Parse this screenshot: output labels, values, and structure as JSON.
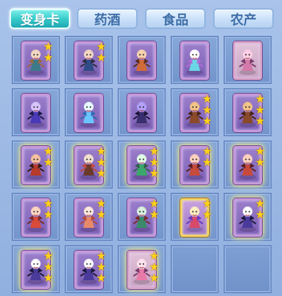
{
  "tabs": [
    {
      "label": "变身卡",
      "active": true
    },
    {
      "label": "药酒",
      "active": false
    },
    {
      "label": "食品",
      "active": false
    },
    {
      "label": "农产",
      "active": false
    }
  ],
  "icons": {
    "star": "★"
  },
  "items": [
    {
      "name": "transform-card-archer-girl",
      "stars": 2,
      "frame": "purple",
      "figure": "archer"
    },
    {
      "name": "transform-card-blade-girl",
      "stars": 2,
      "frame": "purple",
      "figure": "blade"
    },
    {
      "name": "transform-card-fox-warrior",
      "stars": 0,
      "frame": "purple",
      "figure": "fox"
    },
    {
      "name": "transform-card-unicorn",
      "stars": 0,
      "frame": "purple",
      "figure": "unicorn"
    },
    {
      "name": "transform-card-pink-beast",
      "stars": 0,
      "frame": "pink",
      "figure": "beast"
    },
    {
      "name": "transform-card-purple-mage",
      "stars": 0,
      "frame": "purple",
      "figure": "mage"
    },
    {
      "name": "transform-card-ice-dragon",
      "stars": 0,
      "frame": "purple",
      "figure": "dragon"
    },
    {
      "name": "transform-card-dark-knight",
      "stars": 0,
      "frame": "purple",
      "figure": "knight"
    },
    {
      "name": "transform-card-monkey-warrior",
      "stars": 3,
      "frame": "purple",
      "figure": "monkey"
    },
    {
      "name": "transform-card-monkey-warrior-2",
      "stars": 3,
      "frame": "purple",
      "figure": "monkey"
    },
    {
      "name": "transform-card-fire-demon",
      "stars": 2,
      "frame": "purple",
      "figure": "demon",
      "glow": true
    },
    {
      "name": "transform-card-white-haired-general",
      "stars": 3,
      "frame": "purple",
      "figure": "general",
      "glow": true
    },
    {
      "name": "transform-card-green-spirit",
      "stars": 3,
      "frame": "purple",
      "figure": "spirit",
      "glow": true
    },
    {
      "name": "transform-card-red-hair-fighter",
      "stars": 2,
      "frame": "purple",
      "figure": "fighter",
      "glow": true
    },
    {
      "name": "transform-card-red-hair-fighter-2",
      "stars": 2,
      "frame": "purple",
      "figure": "fighter",
      "glow": true
    },
    {
      "name": "transform-card-flame-dancer",
      "stars": 2,
      "frame": "purple",
      "figure": "dancer"
    },
    {
      "name": "transform-card-rabbit-girl",
      "stars": 2,
      "frame": "purple",
      "figure": "rabbit"
    },
    {
      "name": "transform-card-goblin-warrior",
      "stars": 2,
      "frame": "purple",
      "figure": "goblin"
    },
    {
      "name": "transform-card-fairy",
      "stars": 2,
      "frame": "gold",
      "figure": "fairy"
    },
    {
      "name": "transform-card-armored-ninja",
      "stars": 2,
      "frame": "purple",
      "figure": "ninja",
      "glow": true
    },
    {
      "name": "transform-card-armored-ninja-2",
      "stars": 3,
      "frame": "purple",
      "figure": "ninja",
      "glow": true
    },
    {
      "name": "transform-card-armored-ninja-3",
      "stars": 3,
      "frame": "purple",
      "figure": "ninja"
    },
    {
      "name": "transform-card-pink-hair-maiden",
      "stars": 3,
      "frame": "pink",
      "figure": "maiden",
      "glow": true
    },
    {
      "name": "empty-slot",
      "empty": true
    },
    {
      "name": "empty-slot",
      "empty": true
    }
  ]
}
